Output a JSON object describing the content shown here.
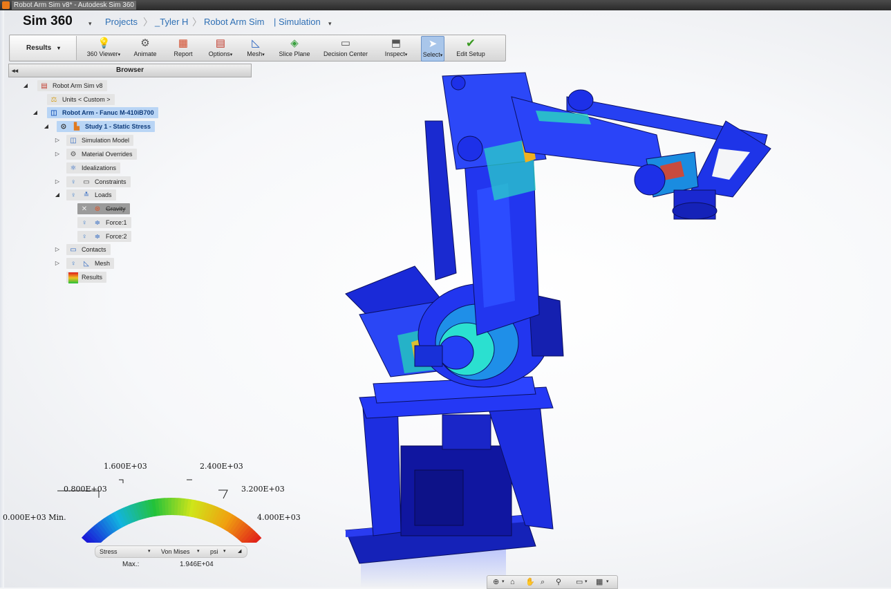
{
  "window": {
    "title": "Robot Arm Sim v8* - Autodesk Sim 360"
  },
  "header": {
    "app_name": "Sim 360",
    "breadcrumbs": [
      "Projects",
      "_Tyler H",
      "Robot Arm Sim",
      "| Simulation"
    ]
  },
  "toolbar": {
    "mode_label": "Results",
    "buttons": [
      {
        "label": "360 Viewer",
        "icon": "viewer-360-icon"
      },
      {
        "label": "Animate",
        "icon": "animate-icon"
      },
      {
        "label": "Report",
        "icon": "report-icon"
      },
      {
        "label": "Options",
        "icon": "options-icon"
      },
      {
        "label": "Mesh",
        "icon": "mesh-icon"
      },
      {
        "label": "Slice Plane",
        "icon": "slice-plane-icon"
      },
      {
        "label": "Decision Center",
        "icon": "decision-center-icon"
      },
      {
        "label": "Inspect",
        "icon": "inspect-icon"
      },
      {
        "label": "Select",
        "icon": "select-cursor-icon"
      },
      {
        "label": "Edit Setup",
        "icon": "checkmark-icon"
      }
    ]
  },
  "browser": {
    "title": "Browser",
    "tree": [
      {
        "label": "Robot Arm Sim v8"
      },
      {
        "label": "Units < Custom >"
      },
      {
        "label": "Robot Arm - Fanuc M-410iB700"
      },
      {
        "label": "Study 1 - Static Stress"
      },
      {
        "label": "Simulation Model"
      },
      {
        "label": "Material Overrides"
      },
      {
        "label": "Idealizations"
      },
      {
        "label": "Constraints"
      },
      {
        "label": "Loads"
      },
      {
        "label": "Gravity"
      },
      {
        "label": "Force:1"
      },
      {
        "label": "Force:2"
      },
      {
        "label": "Contacts"
      },
      {
        "label": "Mesh"
      },
      {
        "label": "Results"
      }
    ]
  },
  "legend": {
    "labels": [
      "0.000E+03 Min.",
      "0.800E+03",
      "1.600E+03",
      "2.400E+03",
      "3.200E+03",
      "4.000E+03"
    ],
    "colors": [
      "#1a1ad8",
      "#12b4e0",
      "#23c23a",
      "#cfe51a",
      "#f0a010",
      "#e01b1b"
    ]
  },
  "result_selector": {
    "quantity": "Stress",
    "component": "Von Mises",
    "unit": "psi"
  },
  "max": {
    "label": "Max.:",
    "value": "1.946E+04"
  }
}
